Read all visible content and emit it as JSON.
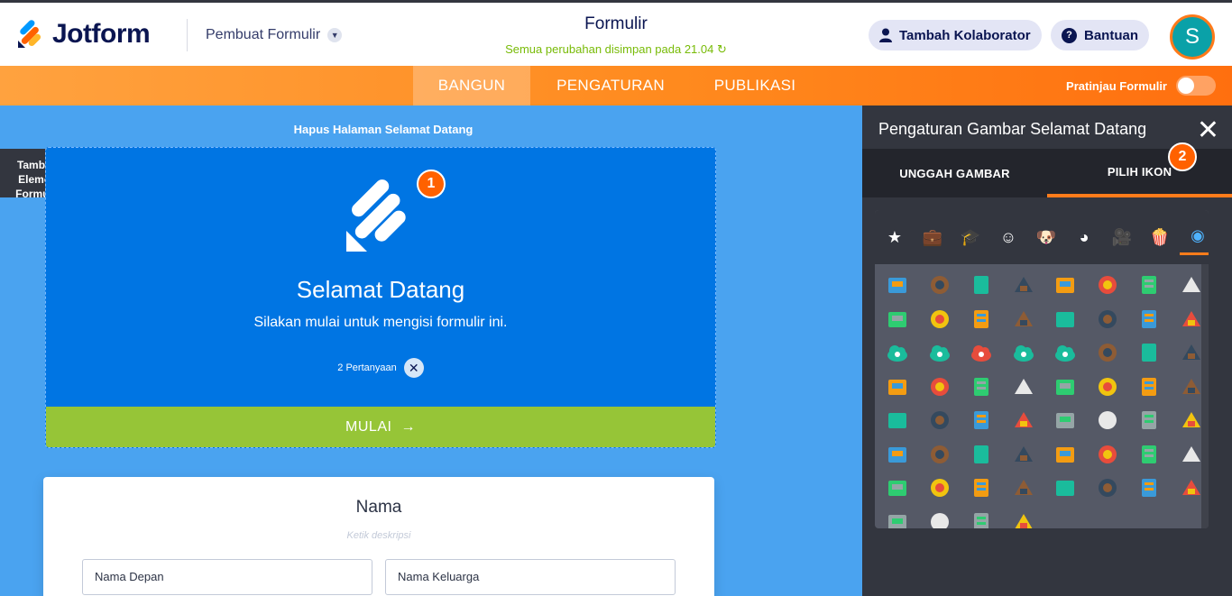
{
  "brand": {
    "name": "Jotform"
  },
  "header": {
    "builder_label": "Pembuat Formulir",
    "form_title": "Formulir",
    "saved_status": "Semua perubahan disimpan pada 21.04",
    "collab_label": "Tambah Kolaborator",
    "help_label": "Bantuan",
    "avatar_initial": "S"
  },
  "nav": {
    "tabs": [
      "BANGUN",
      "PENGATURAN",
      "PUBLIKASI"
    ],
    "active_tab": "BANGUN",
    "preview_label": "Pratinjau Formulir",
    "preview_on": false
  },
  "canvas": {
    "delete_welcome": "Hapus Halaman Selamat Datang",
    "add_element": "Tambah Elemen Formulir",
    "welcome": {
      "title": "Selamat Datang",
      "subtitle": "Silakan mulai untuk mengisi formulir ini.",
      "question_count": "2 Pertanyaan",
      "start_button": "MULAI"
    },
    "name_field": {
      "title": "Nama",
      "description_placeholder": "Ketik deskripsi",
      "first_name": "Nama Depan",
      "last_name": "Nama Keluarga"
    },
    "badges": [
      "1",
      "2"
    ]
  },
  "panel": {
    "title": "Pengaturan Gambar Selamat Datang",
    "tabs": [
      "UNGGAH GAMBAR",
      "PILIH IKON"
    ],
    "active_tab": "PILIH IKON",
    "categories": [
      "star",
      "briefcase",
      "graduation-cap",
      "smiley",
      "dog",
      "pacman",
      "video-camera",
      "popcorn",
      "eye"
    ],
    "active_category": "eye",
    "icons": [
      "id-card",
      "bank",
      "presentation",
      "briefcase",
      "buildings",
      "growth-chart",
      "pie-chart",
      "donut-chart",
      "laptop",
      "money",
      "tag",
      "map-pin",
      "map",
      "envelope",
      "camera",
      "wallet",
      "cloud-check",
      "cloud-download",
      "cloud-error",
      "cloud-sync",
      "cloud-upload",
      "certificate",
      "notepad",
      "donut",
      "water-drop",
      "eye",
      "foam-finger",
      "burger",
      "hotdog",
      "muffin",
      "pizza",
      "speaker",
      "yin-yang",
      "whiteboard",
      "books",
      "office-chair",
      "target",
      "pushpin",
      "clock",
      "calculator",
      "alarm-clock",
      "lightbulb",
      "small-clock",
      "column",
      "mortarboard",
      "backpack",
      "barcode",
      "shopping-basket",
      "person-reading",
      "whistle",
      "first-aid-kit",
      "price-tag",
      "store",
      "chef",
      "radio",
      "cash-register",
      "cash-register-2",
      "rocket",
      "printer",
      "lighthouse"
    ]
  }
}
